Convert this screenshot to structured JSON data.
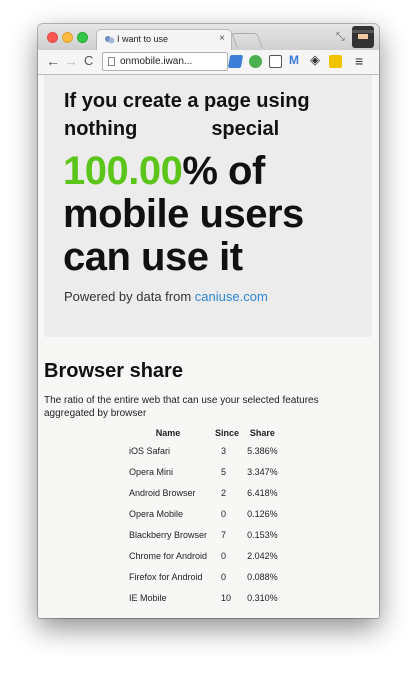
{
  "browser": {
    "tab_title": "I want to use",
    "tab_close": "×",
    "url": "onmobile.iwan...",
    "menu_glyph": "≡",
    "back_glyph": "←",
    "forward_glyph": "→",
    "reload_glyph": "C",
    "star_glyph": "☆"
  },
  "hero": {
    "line1a": "If you create a page using",
    "line2a": "nothing",
    "line2b": "special",
    "percent": "100.00",
    "percent_suffix": "% of",
    "line4": "mobile users",
    "line5": "can use it",
    "powered_prefix": "Powered by data from ",
    "powered_link": "caniuse.com"
  },
  "share": {
    "title": "Browser share",
    "description": "The ratio of the entire web that can use your selected features aggregated by browser",
    "headers": [
      "Name",
      "Since",
      "Share"
    ],
    "rows": [
      {
        "name": "iOS Safari",
        "since": "3",
        "share": "5.386%"
      },
      {
        "name": "Opera Mini",
        "since": "5",
        "share": "3.347%"
      },
      {
        "name": "Android Browser",
        "since": "2",
        "share": "6.418%"
      },
      {
        "name": "Opera Mobile",
        "since": "0",
        "share": "0.126%"
      },
      {
        "name": "Blackberry Browser",
        "since": "7",
        "share": "0.153%"
      },
      {
        "name": "Chrome for Android",
        "since": "0",
        "share": "2.042%"
      },
      {
        "name": "Firefox for Android",
        "since": "0",
        "share": "0.088%"
      },
      {
        "name": "IE Mobile",
        "since": "10",
        "share": "0.310%"
      }
    ]
  },
  "colors": {
    "accent_green": "#5bc51a",
    "link_blue": "#2d86d6"
  },
  "icons": [
    "close-window-icon",
    "minimize-window-icon",
    "zoom-window-icon",
    "favicon-icon",
    "back-icon",
    "forward-icon",
    "reload-icon",
    "page-icon",
    "bookmark-star-icon",
    "menu-icon",
    "avatar-icon"
  ]
}
